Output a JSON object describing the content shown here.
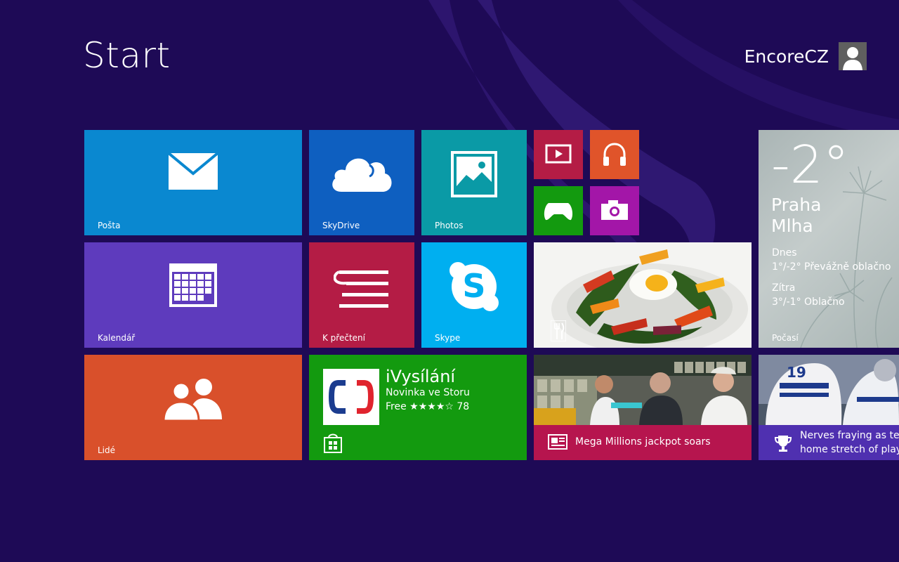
{
  "header": {
    "title": "Start",
    "user_name": "EncoreCZ"
  },
  "tiles": {
    "mail": {
      "label": "Pošta",
      "color": "#0a88d0",
      "icon": "mail-icon"
    },
    "skydrive": {
      "label": "SkyDrive",
      "color": "#0e5fc0",
      "icon": "cloud-icon"
    },
    "photos": {
      "label": "Photos",
      "color": "#0a9aa6",
      "icon": "picture-icon"
    },
    "video": {
      "color": "#b41c45",
      "icon": "video-icon"
    },
    "music": {
      "color": "#e0542a",
      "icon": "headphones-icon"
    },
    "games": {
      "color": "#139a0f",
      "icon": "xbox-controller-icon"
    },
    "camera": {
      "color": "#a316a8",
      "icon": "camera-icon"
    },
    "calendar": {
      "label": "Kalendář",
      "color": "#5e3bbd",
      "icon": "calendar-icon"
    },
    "reading": {
      "label": "K přečtení",
      "color": "#b41c45",
      "icon": "reading-list-icon"
    },
    "skype": {
      "label": "Skype",
      "color": "#00aff0",
      "icon": "skype-icon"
    },
    "food": {
      "icon": "fork-knife-icon"
    },
    "people": {
      "label": "Lidé",
      "color": "#d9502b",
      "icon": "people-icon"
    },
    "store": {
      "color": "#139a0f",
      "app_name": "iVysílání",
      "subtitle": "Novinka ve Storu",
      "price": "Free",
      "stars": "★★★★☆",
      "rating_value": 4,
      "rating_count": "78",
      "icon": "store-icon"
    },
    "weather": {
      "temperature": "-2°",
      "city": "Praha",
      "condition": "Mlha",
      "today_label": "Dnes",
      "today_forecast": "1°/-2° Převážně oblačno",
      "tomorrow_label": "Zítra",
      "tomorrow_forecast": "3°/-1° Oblačno",
      "label": "Počasí"
    },
    "news": {
      "headline": "Mega Millions jackpot soars",
      "color": "#b6154e",
      "icon": "newspaper-icon"
    },
    "sport": {
      "headline_line1": "Nerves fraying as tean",
      "headline_line2": "home stretch of playof",
      "color": "#4f30b0",
      "icon": "trophy-icon"
    }
  }
}
